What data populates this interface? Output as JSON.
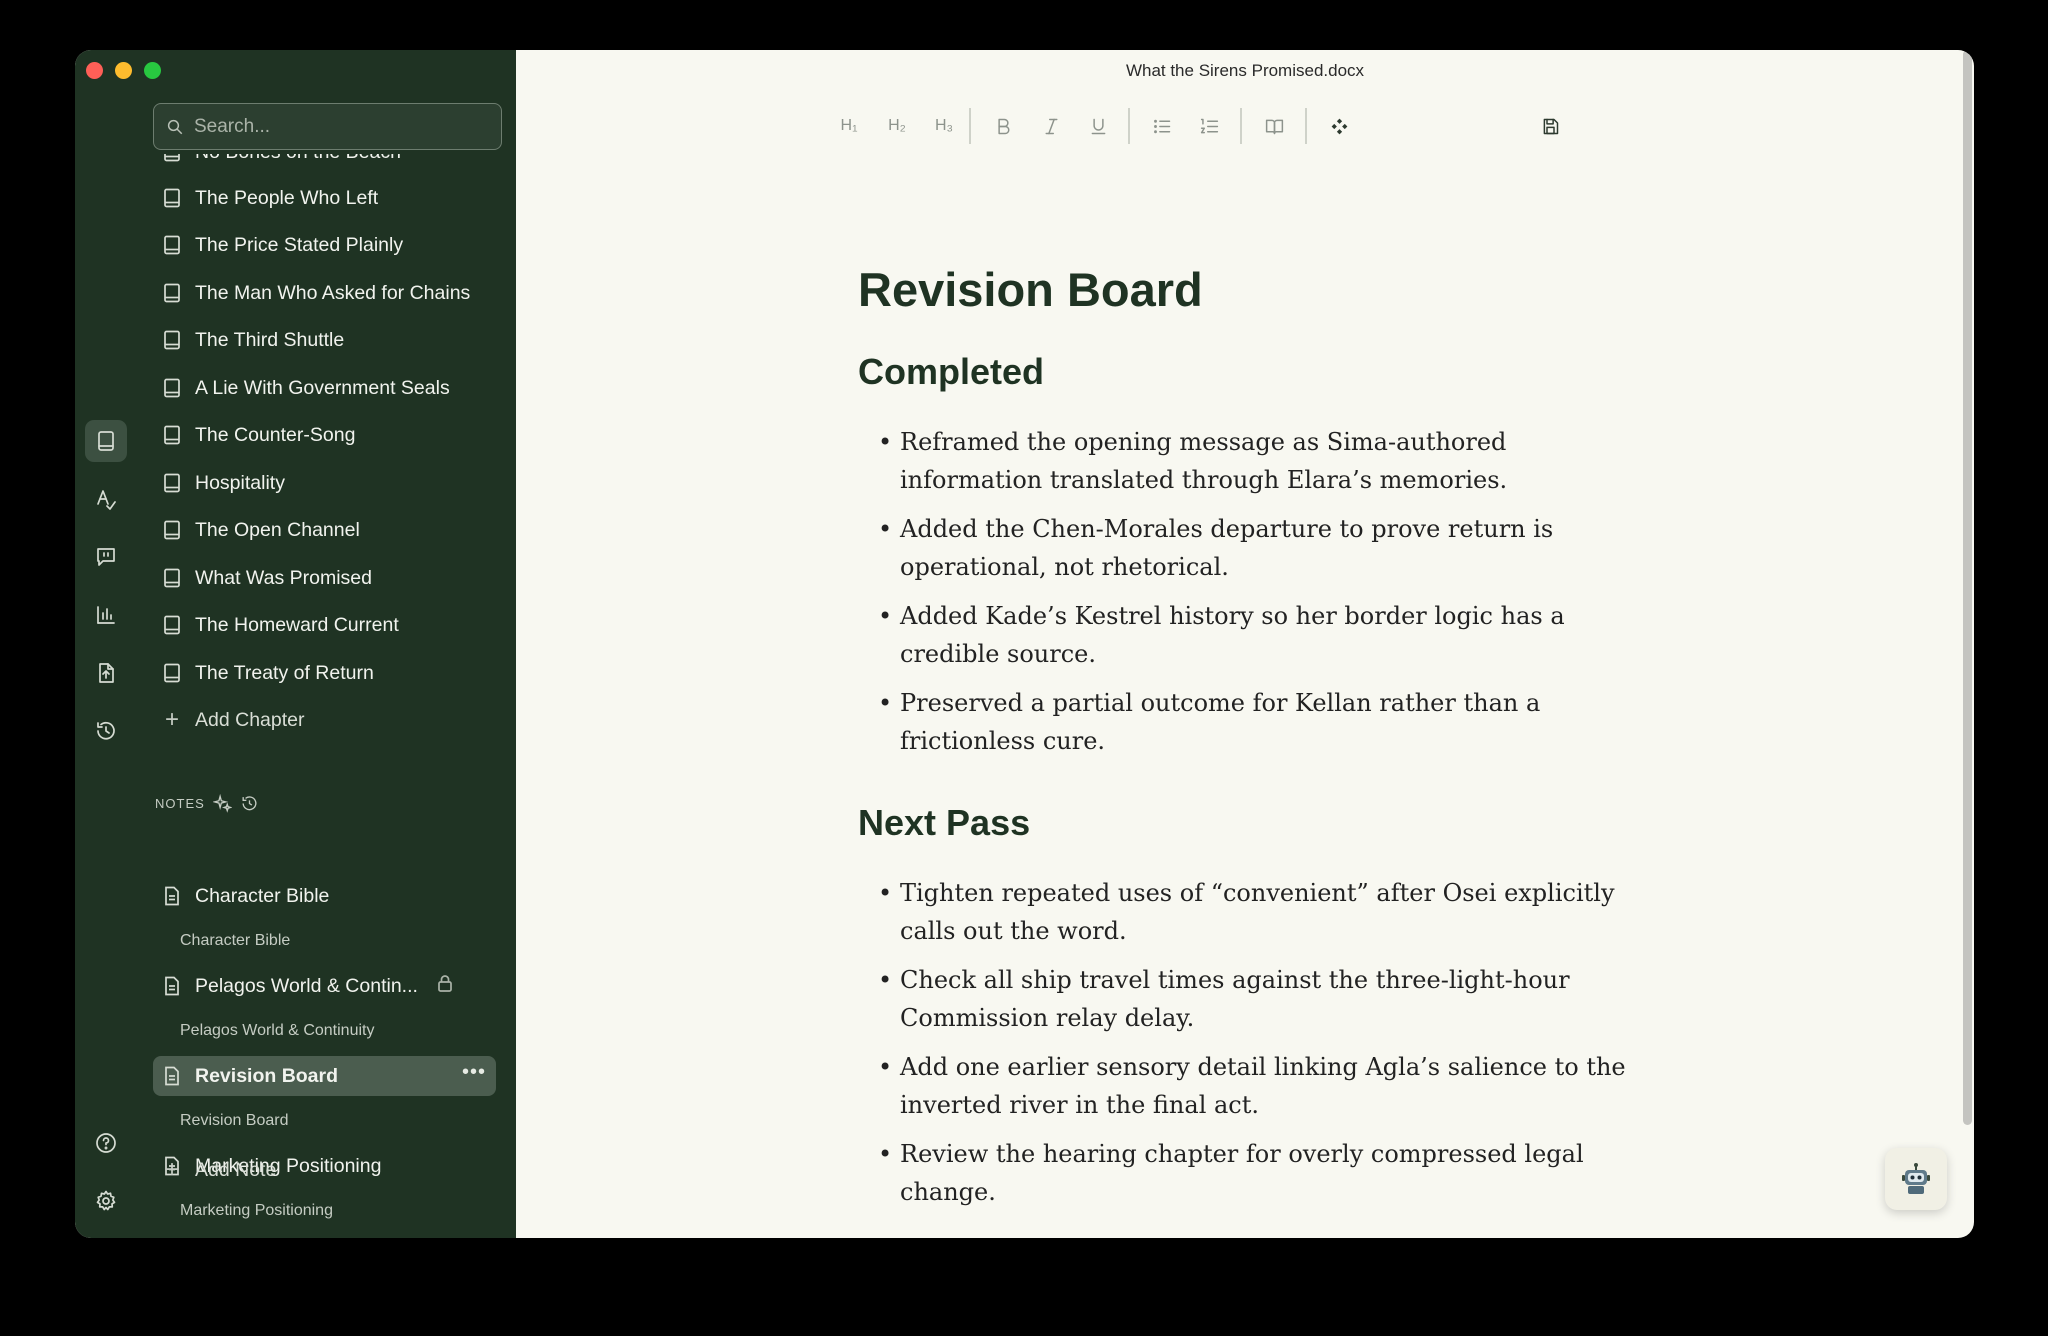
{
  "window": {
    "title": "What the Sirens Promised.docx"
  },
  "search": {
    "placeholder": "Search..."
  },
  "chapters": [
    "No Bones on the Beach",
    "The People Who Left",
    "The Price Stated Plainly",
    "The Man Who Asked for Chains",
    "The Third Shuttle",
    "A Lie With Government Seals",
    "The Counter-Song",
    "Hospitality",
    "The Open Channel",
    "What Was Promised",
    "The Homeward Current",
    "The Treaty of Return"
  ],
  "add_chapter": "Add Chapter",
  "notes_header": "NOTES",
  "notes": [
    {
      "title": "Character Bible",
      "sub": "Character Bible"
    },
    {
      "title": "Pelagos World & Contin...",
      "sub": "Pelagos World & Continuity"
    },
    {
      "title": "Revision Board",
      "sub": "Revision Board"
    },
    {
      "title": "Marketing Positioning",
      "sub": "Marketing Positioning"
    }
  ],
  "add_note": "Add Note",
  "toolbar": {
    "h1": "H₁",
    "h2": "H₂",
    "h3": "H₃"
  },
  "document": {
    "heading": "Revision Board",
    "sections": [
      {
        "heading": "Completed",
        "items": [
          "Reframed the opening message as Sima-authored information translated through Elara’s memories.",
          "Added the Chen-Morales departure to prove return is operational, not rhetorical.",
          "Added Kade’s Kestrel history so her border logic has a credible source.",
          "Preserved a partial outcome for Kellan rather than a frictionless cure."
        ]
      },
      {
        "heading": "Next Pass",
        "items": [
          "Tighten repeated uses of “convenient” after Osei explicitly calls out the word.",
          "Check all ship travel times against the three-light-hour Commission relay delay.",
          "Add one earlier sensory detail linking Agla’s salience to the inverted river in the final act.",
          "Review the hearing chapter for overly compressed legal change."
        ]
      }
    ]
  },
  "colors": {
    "sidebar": "#1f3323",
    "editor_bg": "#f8f8f1",
    "selected": "#4b5d4f"
  }
}
